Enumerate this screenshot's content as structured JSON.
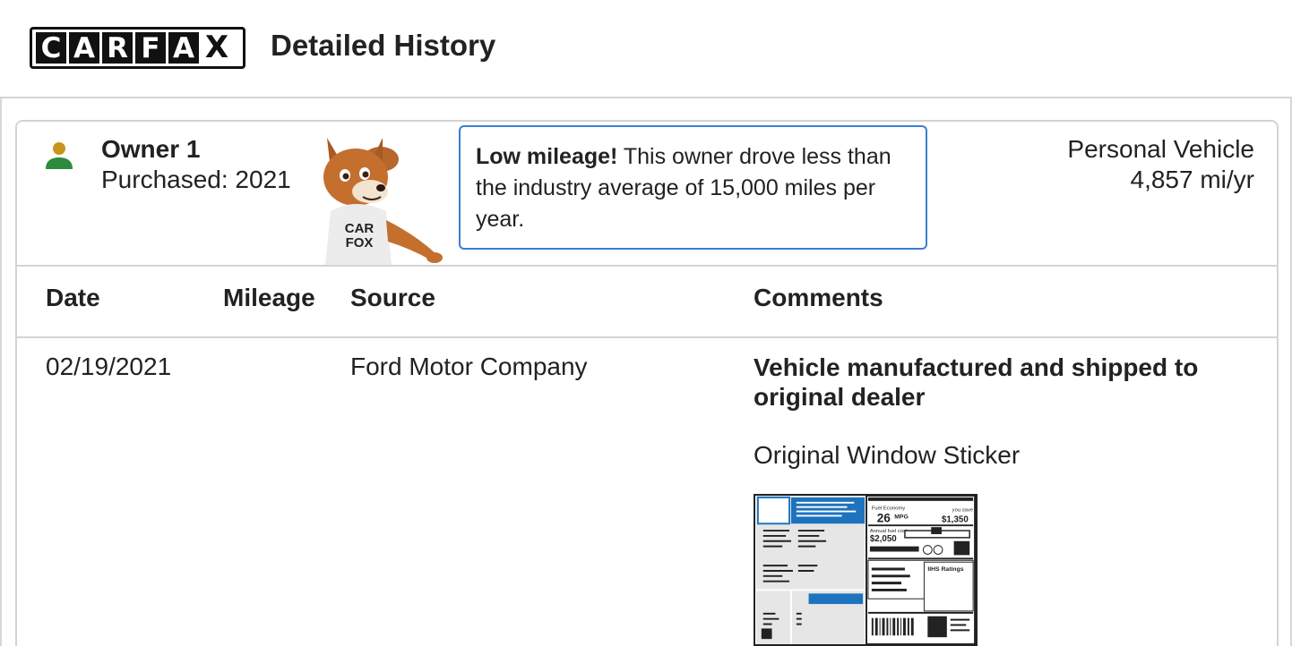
{
  "header": {
    "logo_letters": [
      "C",
      "A",
      "R",
      "F",
      "A",
      "X"
    ],
    "title": "Detailed History"
  },
  "owner": {
    "name": "Owner 1",
    "purchased": "Purchased: 2021",
    "vehicle_type": "Personal Vehicle",
    "miles_per_year": "4,857 mi/yr",
    "icon": "person-icon",
    "icon_color": "#2e8b3e",
    "head_color": "#c8941a"
  },
  "callout": {
    "bold": "Low mileage!",
    "text": " This owner drove less than the industry average of 15,000 miles per year."
  },
  "mascot": {
    "shirt_text": "CAR FOX"
  },
  "table": {
    "headers": {
      "date": "Date",
      "mileage": "Mileage",
      "source": "Source",
      "comments": "Comments"
    },
    "rows": [
      {
        "date": "02/19/2021",
        "mileage": "",
        "source": "Ford Motor Company",
        "comment_title": "Vehicle manufactured and shipped to original dealer",
        "comment_link": "Original Window Sticker"
      }
    ]
  },
  "sticker": {
    "mpg": "26",
    "mpg_unit": "MPG",
    "save": "$1,350",
    "save_label": "you save",
    "fuel_cost": "$2,050",
    "fuel_cost_label": "Annual fuel cost",
    "fuel_label": "Fuel Economy",
    "ratings_label": "IIHS Ratings",
    "accent": "#1e73be"
  }
}
